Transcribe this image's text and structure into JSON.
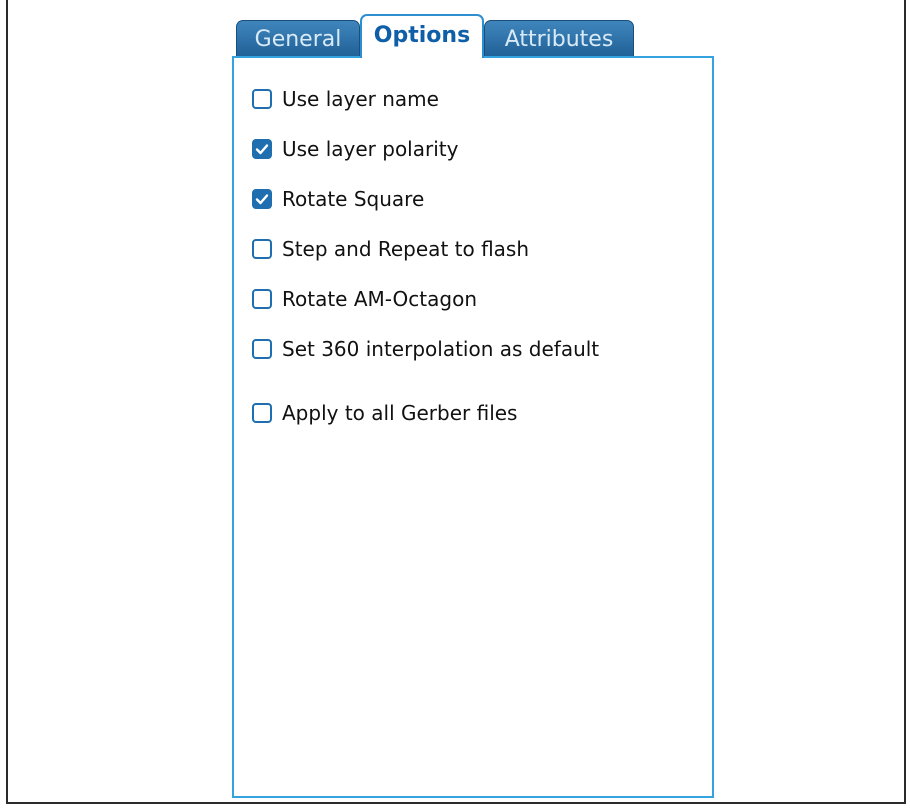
{
  "tabs": [
    {
      "label": "General",
      "active": false
    },
    {
      "label": "Options",
      "active": true
    },
    {
      "label": "Attributes",
      "active": false
    }
  ],
  "options": [
    {
      "label": "Use layer name",
      "checked": false
    },
    {
      "label": "Use layer polarity",
      "checked": true
    },
    {
      "label": "Rotate Square",
      "checked": true
    },
    {
      "label": "Step and Repeat to flash",
      "checked": false
    },
    {
      "label": "Rotate AM-Octagon",
      "checked": false
    },
    {
      "label": "Set 360 interpolation as default",
      "checked": false
    },
    {
      "label": "Apply to all Gerber files",
      "checked": false
    }
  ],
  "colors": {
    "accent": "#1f6fb0",
    "panel_border": "#35a3e0",
    "tab_inactive": "#2a6fa8"
  },
  "icons": {
    "checkmark": "check-icon"
  }
}
